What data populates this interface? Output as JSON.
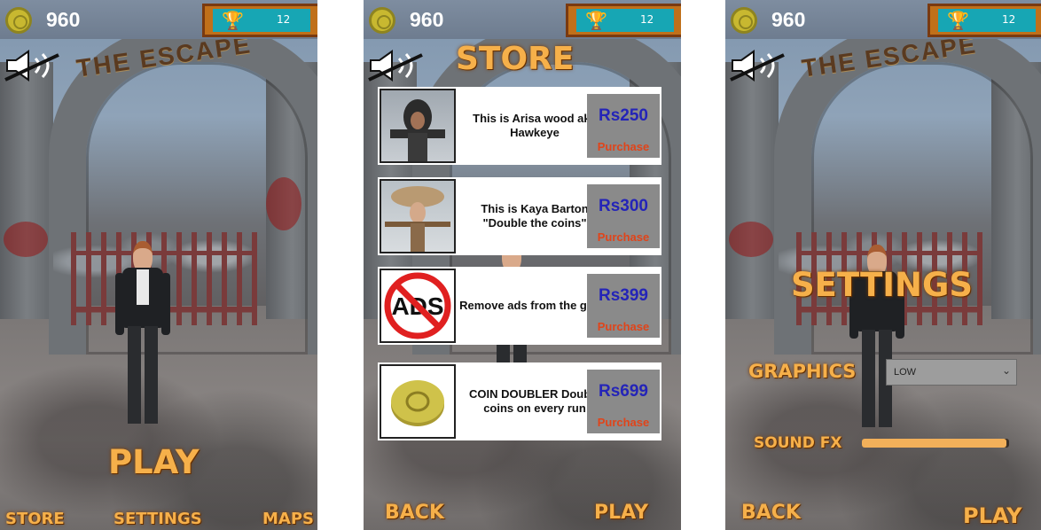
{
  "hud": {
    "coins": "960",
    "trophies": "12"
  },
  "sign": {
    "title": "THE ESCAPE"
  },
  "main_menu": {
    "play_label": "PLAY",
    "store_label": "STORE",
    "settings_label": "SETTINGS",
    "maps_label": "MAPS"
  },
  "store": {
    "title": "STORE",
    "items": [
      {
        "description": "This is Arisa wood aka Hawkeye",
        "price": "Rs250",
        "purchase_label": "Purchase",
        "icon": "hooded-character"
      },
      {
        "description": "This is Kaya Barton \"Double the coins\"",
        "price": "Rs300",
        "purchase_label": "Purchase",
        "icon": "hat-character"
      },
      {
        "description": "Remove ads from the game",
        "price": "Rs399",
        "purchase_label": "Purchase",
        "icon": "no-ads-icon"
      },
      {
        "description": "COIN DOUBLER Double coins on every run",
        "price": "Rs699",
        "purchase_label": "Purchase",
        "icon": "coin-icon"
      }
    ],
    "back_label": "BACK",
    "play_label": "PLAY"
  },
  "settings": {
    "title": "SETTINGS",
    "graphics_label": "GRAPHICS",
    "graphics_value": "LOW",
    "sound_fx_label": "SOUND FX",
    "sound_fx_level": 0.98,
    "back_label": "BACK",
    "play_label": "PLAY"
  },
  "colors": {
    "accent_orange": "#f6b04a",
    "price_blue": "#2424b8",
    "purchase_red": "#e0441a",
    "hud_teal": "#17a6b4"
  }
}
